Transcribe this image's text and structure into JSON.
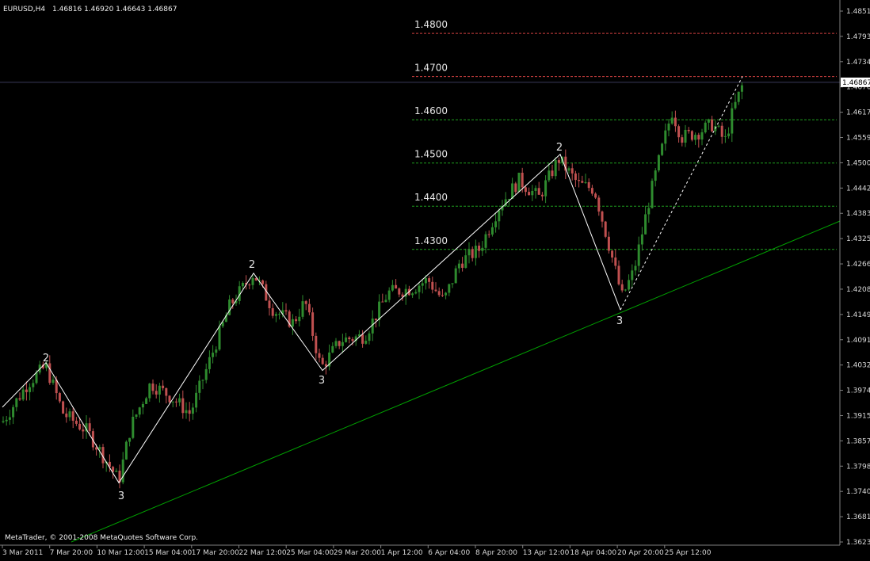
{
  "header": {
    "symbol": "EURUSD,H4",
    "ohlc": "1.46816 1.46920 1.46643 1.46867"
  },
  "footer": {
    "copyright": "MetaTrader, © 2001-2008 MetaQuotes Software Corp."
  },
  "price_marker": {
    "label": "1.46867",
    "value": 1.46867
  },
  "colors": {
    "background": "#000000",
    "bull_candle": "#2e8b2e",
    "bear_candle": "#c05050",
    "trendline": "#00a000",
    "wave_line": "#ffffff",
    "level_red": "#d04040",
    "level_green": "#1f9e1f",
    "axis": "#808080"
  },
  "chart_data": {
    "type": "candlestick",
    "title": "EURUSD,H4",
    "price_axis_ticks": [
      "1.48515",
      "1.47930",
      "1.47345",
      "1.46760",
      "1.46175",
      "1.45590",
      "1.45005",
      "1.44420",
      "1.43835",
      "1.43250",
      "1.42665",
      "1.42080",
      "1.41495",
      "1.40910",
      "1.40325",
      "1.39740",
      "1.39155",
      "1.38570",
      "1.37985",
      "1.37400",
      "1.36815",
      "1.36230"
    ],
    "ylim": [
      1.3623,
      1.488
    ],
    "time_axis_labels": [
      "3 Mar 2011",
      "7 Mar 20:00",
      "10 Mar 12:00",
      "15 Mar 04:00",
      "17 Mar 20:00",
      "22 Mar 12:00",
      "25 Mar 04:00",
      "29 Mar 20:00",
      "1 Apr 12:00",
      "6 Apr 04:00",
      "8 Apr 20:00",
      "13 Apr 12:00",
      "18 Apr 04:00",
      "20 Apr 20:00",
      "25 Apr 12:00"
    ],
    "levels": [
      {
        "label": "1.4800",
        "value": 1.48,
        "color": "red"
      },
      {
        "label": "1.4700",
        "value": 1.47,
        "color": "red"
      },
      {
        "label": "1.4600",
        "value": 1.46,
        "color": "green"
      },
      {
        "label": "1.4500",
        "value": 1.45,
        "color": "green"
      },
      {
        "label": "1.4400",
        "value": 1.44,
        "color": "green"
      },
      {
        "label": "1.4300",
        "value": 1.43,
        "color": "green"
      }
    ],
    "wave_labels": [
      {
        "text": "2",
        "t": "5 Mar 2011",
        "price": 1.4038
      },
      {
        "text": "3",
        "t": "10 Mar 2011",
        "price": 1.376
      },
      {
        "text": "2",
        "t": "21 Mar 2011",
        "price": 1.4245
      },
      {
        "text": "3",
        "t": "25 Mar 2011",
        "price": 1.402
      },
      {
        "text": "2",
        "t": "13 Apr 2011",
        "price": 1.452
      },
      {
        "text": "3",
        "t": "18 Apr 2011",
        "price": 1.416
      }
    ]
  }
}
